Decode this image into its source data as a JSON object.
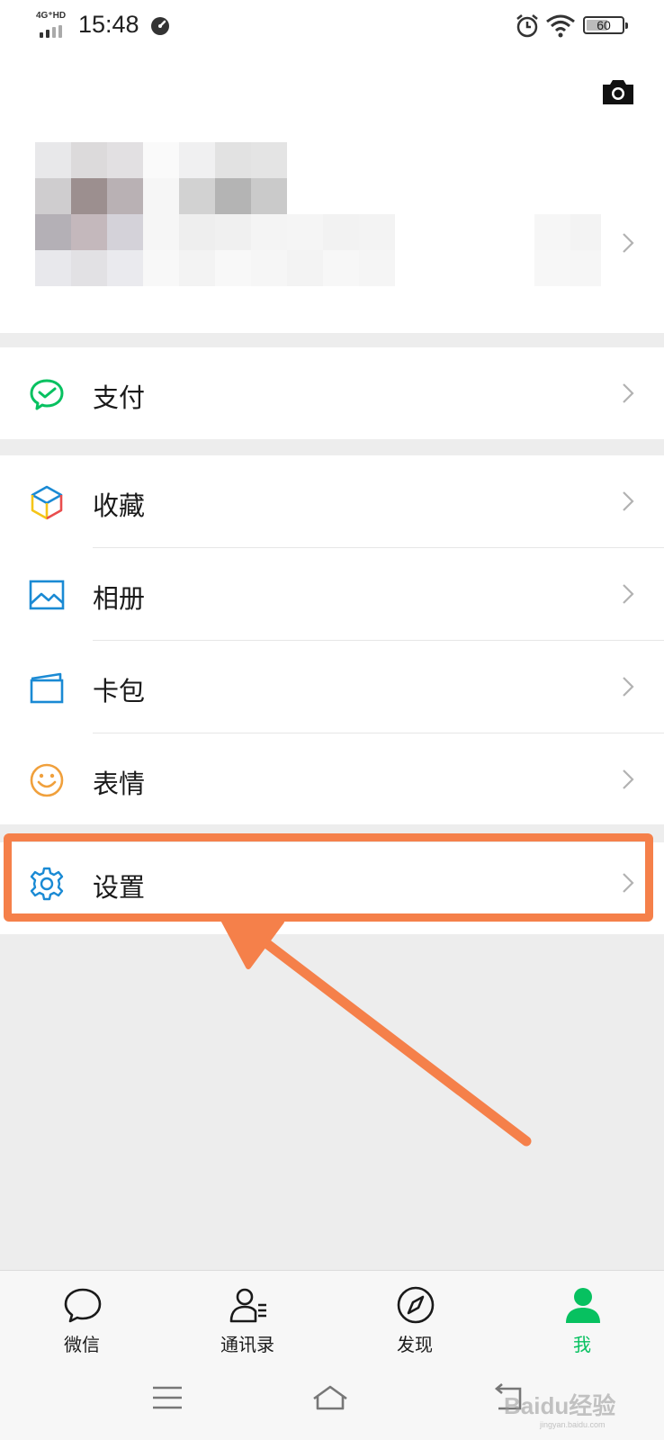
{
  "status_bar": {
    "network": "4G⁺HD",
    "time": "15:48",
    "battery": "60",
    "battery_level": 0.6
  },
  "header": {
    "camera_icon": "camera-icon"
  },
  "menu": {
    "pay": {
      "label": "支付",
      "icon": "wechat-pay-icon",
      "color": "#07c160"
    },
    "items": [
      {
        "label": "收藏",
        "icon": "favorites-cube-icon"
      },
      {
        "label": "相册",
        "icon": "album-icon",
        "color": "#1a8ad4"
      },
      {
        "label": "卡包",
        "icon": "card-wallet-icon",
        "color": "#1a8ad4"
      },
      {
        "label": "表情",
        "icon": "sticker-smile-icon",
        "color": "#f0a03c"
      }
    ],
    "settings": {
      "label": "设置",
      "icon": "gear-icon",
      "color": "#1a8ad4"
    }
  },
  "annotation": {
    "color": "#f5804a"
  },
  "tabbar": {
    "tabs": [
      {
        "label": "微信",
        "icon": "chat-bubble-icon",
        "active": false
      },
      {
        "label": "通讯录",
        "icon": "contacts-icon",
        "active": false
      },
      {
        "label": "发现",
        "icon": "compass-icon",
        "active": false
      },
      {
        "label": "我",
        "icon": "person-icon",
        "active": true
      }
    ],
    "active_color": "#07c160"
  },
  "watermark": {
    "text": "Baidu经验",
    "sub": "jingyan.baidu.com"
  }
}
